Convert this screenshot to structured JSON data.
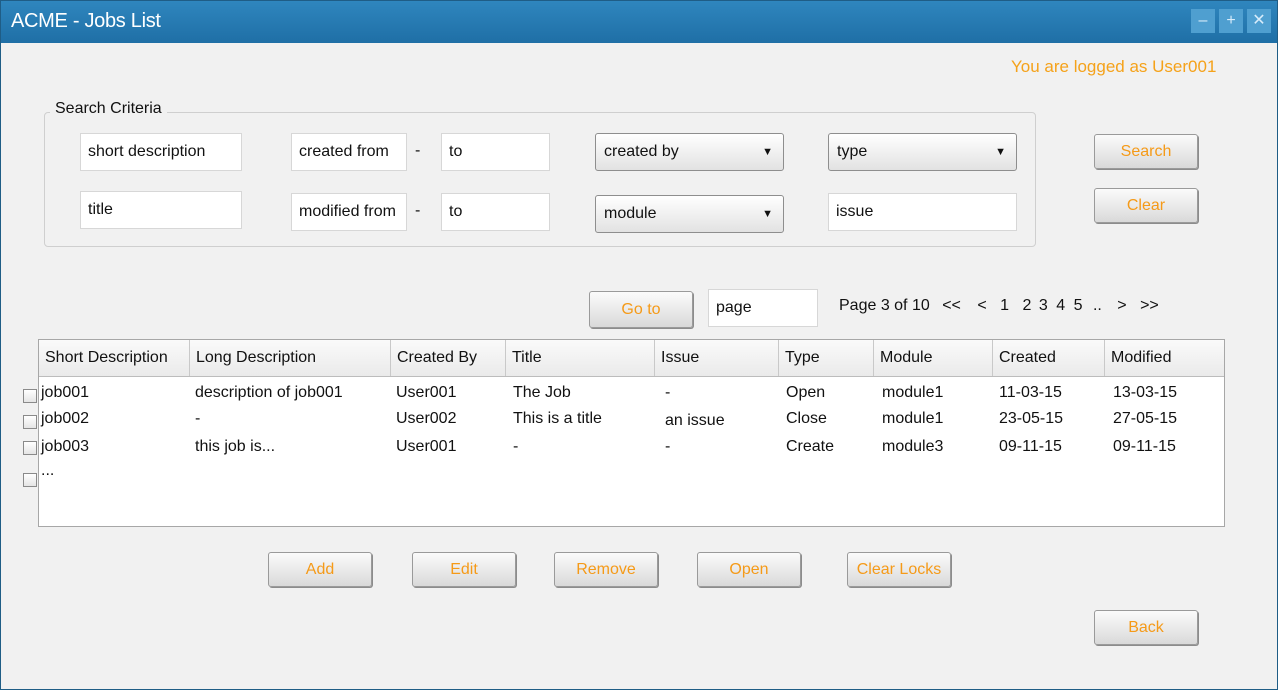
{
  "window": {
    "title": "ACME - Jobs List",
    "controls": [
      "–",
      "+",
      "✕"
    ]
  },
  "user_status": "You are logged as User001",
  "search": {
    "legend": "Search Criteria",
    "short_description": "short description",
    "created_from": "created from",
    "created_to": "to",
    "created_by": "created by",
    "type": "type",
    "title": "title",
    "modified_from": "modified from",
    "modified_to": "to",
    "module": "module",
    "issue": "issue",
    "dash": "-",
    "search_button": "Search",
    "clear_button": "Clear"
  },
  "pager": {
    "goto_button": "Go to",
    "page_input": "page",
    "page_info": "Page 3 of 10",
    "first": "<<",
    "prev": "<",
    "pages": [
      "1",
      "2",
      "3",
      "4",
      "5"
    ],
    "ellipsis": "..",
    "next": ">",
    "last": ">>"
  },
  "table": {
    "columns": [
      "Short Description",
      "Long Description",
      "Created By",
      "Title",
      "Issue",
      "Type",
      "Module",
      "Created",
      "Modified"
    ],
    "rows": [
      [
        "job001",
        "description of job001",
        "User001",
        "The Job",
        "-",
        "Open",
        "module1",
        "11-03-15",
        "13-03-15"
      ],
      [
        "job002",
        "-",
        "User002",
        "This is a title",
        "an issue",
        "Close",
        "module1",
        "23-05-15",
        "27-05-15"
      ],
      [
        "job003",
        "this job is...",
        "User001",
        "-",
        "-",
        "Create",
        "module3",
        "09-11-15",
        "09-11-15"
      ],
      [
        "...",
        "",
        "",
        "",
        "",
        "",
        "",
        "",
        ""
      ]
    ]
  },
  "actions": {
    "add": "Add",
    "edit": "Edit",
    "remove": "Remove",
    "open": "Open",
    "clear_locks": "Clear Locks",
    "back": "Back"
  },
  "colors": {
    "titlebar": "#1f6fa6",
    "accent": "#f59a18"
  }
}
